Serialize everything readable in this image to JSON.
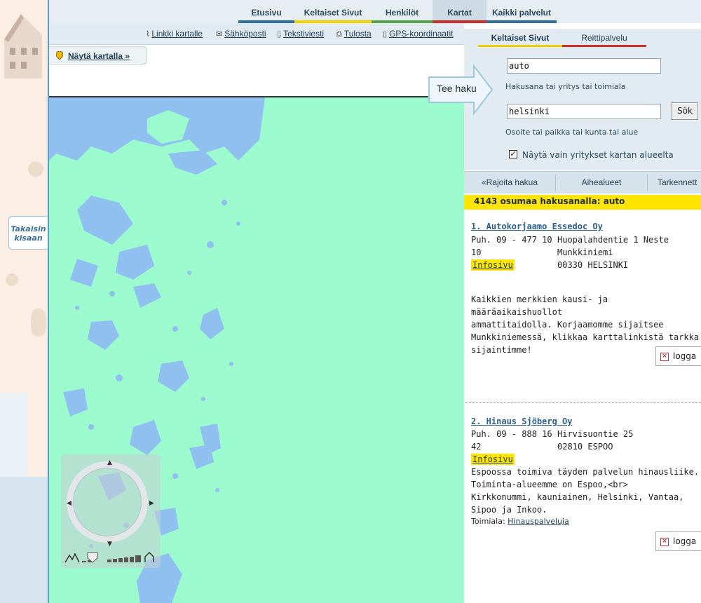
{
  "nav": {
    "tabs": [
      {
        "label": "Etusivu",
        "color": "#2f6fa0"
      },
      {
        "label": "Keltaiset Sivut",
        "color": "#f2d200"
      },
      {
        "label": "Henkilöt",
        "color": "#55a34b"
      },
      {
        "label": "Kartat",
        "color": "#c9302c",
        "active": true
      },
      {
        "label": "Kaikki palvelut",
        "color": "#2f6fa0"
      }
    ]
  },
  "toolbar": {
    "items": [
      {
        "label": "Linkki kartalle",
        "icon": "paperclip-icon"
      },
      {
        "label": "Sähköposti",
        "icon": "envelope-icon"
      },
      {
        "label": "Tekstiviesti",
        "icon": "mobile-phone-icon"
      },
      {
        "label": "Tulosta",
        "icon": "printer-icon"
      },
      {
        "label": "GPS-koordinaatit",
        "icon": "gps-device-icon"
      }
    ]
  },
  "map_controls": {
    "show_on_map": "Näytä kartalla",
    "back_tab": "Takaisin kisaan"
  },
  "search": {
    "tabs": [
      {
        "label": "Keltaiset Sivut",
        "color": "#f2d200",
        "active": true
      },
      {
        "label": "Reittipalvelu",
        "color": "#c9302c"
      }
    ],
    "callout": "Tee haku",
    "what_value": "auto",
    "what_hint": "Hakusana tai yritys tai toimiala",
    "where_value": "helsinki",
    "where_hint": "Osoite tai paikka tai kunta tai alue",
    "submit": "Sök",
    "checkbox_label": "Näytä vain yritykset kartan alueelta",
    "checkbox_checked": true
  },
  "filters": {
    "restrict": "«Rajoita hakua",
    "topics": "Aihealueet",
    "advanced": "Tarkennett"
  },
  "results": {
    "hits_text": "4143 osumaa hakusanalla: auto",
    "items": [
      {
        "title": "1. Autokorjaamo Essedoc Oy",
        "phone_line1": "Puh. 09 - 477 10",
        "phone_line2": "10",
        "address": [
          "Huopalahdentie 1 Neste",
          "Munkkiniemi",
          "00330 HELSINKI"
        ],
        "info_link": "Infosivu",
        "description": [
          "Kaikkien merkkien kausi- ja määräaikaishuollot",
          "ammattitaidolla. Korjaamomme sijaitsee",
          "Munkkiniemessä, klikkaa karttalinkistä tarkka",
          "sijaintimme!"
        ],
        "logo_alt": "logga"
      },
      {
        "title": "2. Hinaus Sjöberg Oy",
        "phone_line1": "Puh. 09 - 888 16",
        "phone_line2": "42",
        "address": [
          "Hirvisuontie 25",
          "02810 ESPOO"
        ],
        "info_link": "Infosivu",
        "description": [
          "Espoossa toimiva täyden palvelun hinausliike.",
          "Toiminta-alueemme on Espoo,<br>",
          "Kirkkonummi, kauniainen, Helsinki, Vantaa,",
          "Sipoo ja Inkoo."
        ],
        "industry_label": "Toimiala:",
        "industry_link": "Hinauspalveluja",
        "logo_alt": "logga"
      }
    ]
  },
  "colors": {
    "map_land": "#9bfbce",
    "map_water": "#8fc0ef",
    "highlight": "#ffe500"
  }
}
